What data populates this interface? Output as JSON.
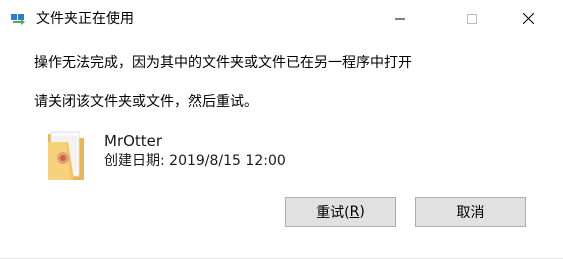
{
  "window": {
    "title": "文件夹正在使用",
    "icons": {
      "app": "folder-move-icon",
      "minimize": "minimize-icon",
      "maximize": "maximize-icon",
      "close": "close-icon"
    }
  },
  "messages": {
    "primary": "操作无法完成，因为其中的文件夹或文件已在另一程序中打开",
    "secondary": "请关闭该文件夹或文件，然后重试。"
  },
  "file": {
    "name": "MrOtter",
    "date_label": "创建日期:",
    "date_value": "2019/8/15 12:00",
    "icon": "folder-icon"
  },
  "buttons": {
    "retry": {
      "label": "重试(",
      "accel": "R",
      "suffix": ")"
    },
    "cancel": {
      "label": "取消"
    }
  },
  "colors": {
    "button_bg": "#e1e1e1",
    "button_border": "#adadad",
    "folder_yellow": "#f3c55f",
    "icon_arrow_green": "#4caf50",
    "icon_arrow_blue": "#2e7bd6"
  }
}
